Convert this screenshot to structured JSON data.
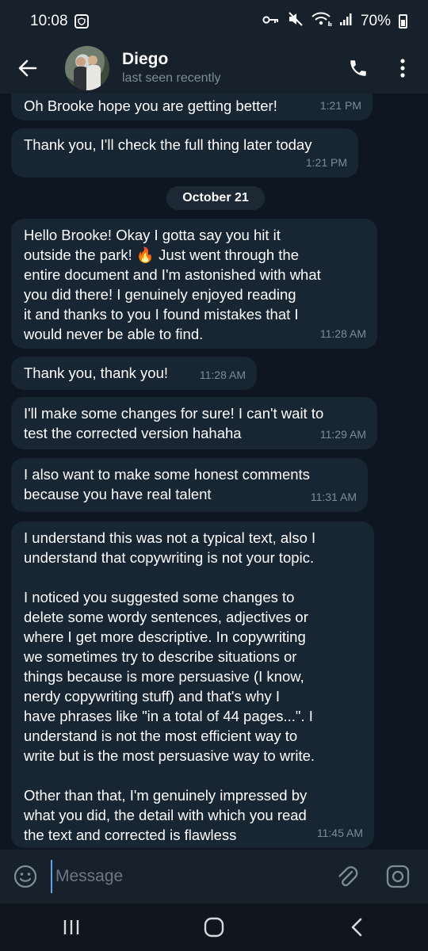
{
  "status_bar": {
    "time": "10:08",
    "battery": "70%"
  },
  "header": {
    "name": "Diego",
    "status": "last seen recently"
  },
  "messages": [
    {
      "text": "Oh Brooke hope you are getting better!",
      "time": "1:21 PM"
    },
    {
      "text": "Thank you, I'll check the full thing later today",
      "time": "1:21 PM"
    },
    {
      "text": "Hello Brooke! Okay I gotta say you hit it\noutside the park! 🔥 Just went through the\nentire document and I'm astonished with what\nyou did there! I genuinely enjoyed reading\nit and thanks to you I found mistakes that I\nwould never be able to find.",
      "time": "11:28 AM"
    },
    {
      "text": "Thank you, thank you!",
      "time": "11:28 AM"
    },
    {
      "text": "I'll make some changes for sure! I can't wait to\ntest the corrected version hahaha",
      "time": "11:29 AM"
    },
    {
      "text": "I also want to make some honest comments\nbecause you have real talent",
      "time": "11:31 AM"
    },
    {
      "text": "I understand this was not a typical text, also I\nunderstand that copywriting is not your topic.\n\nI noticed you suggested some changes to\ndelete some wordy sentences, adjectives or\nwhere I get more descriptive. In copywriting\nwe sometimes try to describe situations or\nthings because is more persuasive (I know,\nnerdy copywriting stuff) and that's why I\nhave phrases like \"in a total of 44 pages...\". I\nunderstand is not the most efficient way to\nwrite but is the most persuasive way to write.\n\nOther than that, I'm genuinely impressed by\nwhat you did, the detail with which you read\nthe text and corrected is flawless",
      "time": "11:45 AM"
    }
  ],
  "date_separator": "October 21",
  "input": {
    "placeholder": "Message"
  },
  "icons": {
    "back": "arrow-left-icon",
    "call": "phone-icon",
    "more": "more-vertical-icon",
    "emoji": "emoji-icon",
    "attach": "paperclip-icon",
    "camera": "camera-icon"
  },
  "colors": {
    "background": "#0e1621",
    "bar": "#17212b",
    "bubble": "#182533",
    "meta_text": "#7d8b99",
    "cursor": "#5fa3e6"
  }
}
